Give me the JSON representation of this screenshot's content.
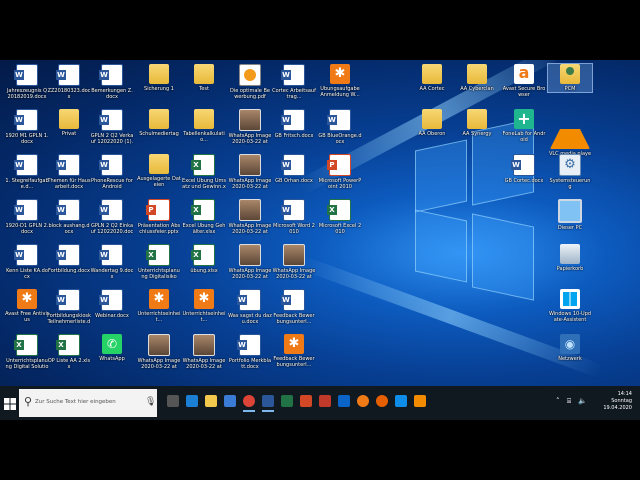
{
  "desktop": {
    "icons": [
      {
        "label": "Jahreszeugnis Q 20182019.docx",
        "type": "word"
      },
      {
        "label": "1920 M1 GPLN 1.docx",
        "type": "word"
      },
      {
        "label": "1. Stegreifaufgabe.d...",
        "type": "word"
      },
      {
        "label": "1920-D1 GPLN 2.docx",
        "type": "word"
      },
      {
        "label": "Kenn Liste KA.docx",
        "type": "word"
      },
      {
        "label": "Avast Free Antivirus",
        "type": "avast"
      },
      {
        "label": "Unterrichtsplanung Digital Solutio",
        "type": "excel"
      },
      {
        "label": "ZZ20180323.docx",
        "type": "word"
      },
      {
        "label": "Privat",
        "type": "folder"
      },
      {
        "label": "Themen für Hausarbeit.docx",
        "type": "word"
      },
      {
        "label": "block aushang.docx",
        "type": "word"
      },
      {
        "label": "Fortbildung.docx",
        "type": "word"
      },
      {
        "label": "Fortbildungskiosk Teilnehmerliste.docx",
        "type": "word"
      },
      {
        "label": "OP Liste AA 2.xlsx",
        "type": "excel"
      },
      {
        "label": "Bemerkungen Z.docx",
        "type": "word"
      },
      {
        "label": "GPLN 2 Q2 Verkauf 12022020 (1).docx",
        "type": "word"
      },
      {
        "label": "PhoneRescue for Android",
        "type": "word"
      },
      {
        "label": "GPLN 2 Q2 Einkauf 12022020.docx",
        "type": "word"
      },
      {
        "label": "Wandertag 9.docx",
        "type": "word"
      },
      {
        "label": "Webinar.docx",
        "type": "word"
      },
      {
        "label": "WhatsApp",
        "type": "whatsapp"
      },
      {
        "label": "Sicherung 1",
        "type": "folder"
      },
      {
        "label": "Schulmediertag",
        "type": "folder"
      },
      {
        "label": "Ausgelagerte Dateien",
        "type": "folder"
      },
      {
        "label": "Präsentation Abschlussfeier.pptx",
        "type": "ppt"
      },
      {
        "label": "Unterrichtsplanung Digitalisiko",
        "type": "excel"
      },
      {
        "label": "Unterrichtseinheit...",
        "type": "avast"
      },
      {
        "label": "WhatsApp Image 2020-03-22 at 2...",
        "type": "photo"
      },
      {
        "label": "Test",
        "type": "folder"
      },
      {
        "label": "Tabellenkalkulatio...",
        "type": "folder"
      },
      {
        "label": "Excel Übung Umsatz und Gewinn.xlsx",
        "type": "excel"
      },
      {
        "label": "Excel Übung Gehälter.xlsx",
        "type": "excel"
      },
      {
        "label": "übung.xlsx",
        "type": "excel"
      },
      {
        "label": "Unterrichtseinheit...",
        "type": "avast"
      },
      {
        "label": "WhatsApp Image 2020-03-22 at 2...",
        "type": "photo"
      },
      {
        "label": "Die optimale Bewerbung.pdf",
        "type": "pdf"
      },
      {
        "label": "WhatsApp Image 2020-03-22 at 2...",
        "type": "photo"
      },
      {
        "label": "WhatsApp Image 2020-03-22 at 2...",
        "type": "photo"
      },
      {
        "label": "WhatsApp Image 2020-03-22 at 2...",
        "type": "photo"
      },
      {
        "label": "WhatsApp Image 2020-03-22 at 2...",
        "type": "photo"
      },
      {
        "label": "Was sagst du dazu.docx",
        "type": "word"
      },
      {
        "label": "Portfolio Merkblatt.docx",
        "type": "word"
      },
      {
        "label": "Cortec Arbeitsauftrag...",
        "type": "word"
      },
      {
        "label": "GB Fritsch.docx",
        "type": "word"
      },
      {
        "label": "GB Orhan.docx",
        "type": "word"
      },
      {
        "label": "Microsoft Word 2010",
        "type": "word"
      },
      {
        "label": "WhatsApp Image 2020-03-22 at 2...",
        "type": "photo"
      },
      {
        "label": "Feedback Bewerbungsunterl...",
        "type": "word"
      },
      {
        "label": "Feedback Bewerbungsunterl...",
        "type": "avast"
      },
      {
        "label": "Übungsaufgabe Anmeldung W...",
        "type": "avast"
      },
      {
        "label": "GB BlueOrange.docx",
        "type": "word"
      },
      {
        "label": "Microsoft PowerPoint 2010",
        "type": "ppt"
      },
      {
        "label": "Microsoft Excel 2010",
        "type": "excel"
      },
      {
        "label": "AA Cortec",
        "type": "folder"
      },
      {
        "label": "AA Oberon",
        "type": "folder"
      },
      {
        "label": "AA Cyberclan",
        "type": "folder"
      },
      {
        "label": "AA Synergy",
        "type": "folder"
      },
      {
        "label": "Avast Secure Browser",
        "type": "avast2"
      },
      {
        "label": "FoneLab for Android",
        "type": "fonelab"
      },
      {
        "label": "GB Cortec.docx",
        "type": "word"
      },
      {
        "label": "PCM",
        "type": "persona"
      },
      {
        "label": "VLC media player",
        "type": "vlc"
      },
      {
        "label": "Systemsteuerung",
        "type": "sys"
      },
      {
        "label": "Dieser PC",
        "type": "pc"
      },
      {
        "label": "Papierkorb",
        "type": "trash"
      },
      {
        "label": "Windows 10-Update-Assistent",
        "type": "win"
      },
      {
        "label": "Netzwerk",
        "type": "net"
      }
    ]
  },
  "taskbar": {
    "search_placeholder": "Zur Suche Text hier eingeben",
    "apps": [
      "task-view",
      "edge",
      "explorer",
      "store",
      "chrome",
      "word",
      "excel",
      "powerpoint",
      "pdf-reader",
      "mail",
      "avast",
      "firefox",
      "teamviewer",
      "vlc"
    ],
    "time": "14:14",
    "day": "Sonntag",
    "date": "19.04.2020"
  },
  "colors": {
    "taskbar": "#101820",
    "desktop_accent": "#0d5bbf",
    "selection": "#78aae6"
  }
}
